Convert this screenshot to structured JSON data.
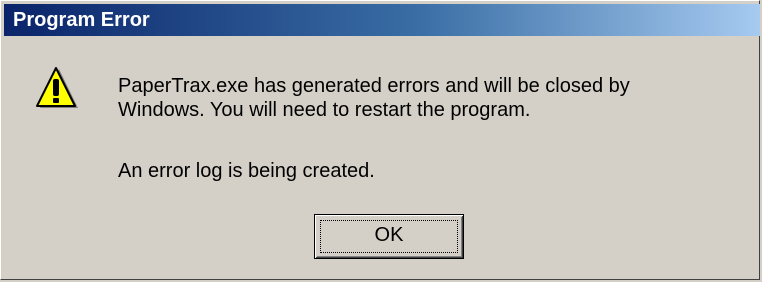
{
  "window": {
    "title": "Program Error"
  },
  "icon": {
    "name": "warning-icon",
    "fill": "#ffff00",
    "outline": "#000000"
  },
  "message": {
    "line1": "PaperTrax.exe has generated errors and will be closed by",
    "line2": "Windows.  You will need to restart the program.",
    "line3": "An error log is being created."
  },
  "buttons": {
    "ok_label": "OK"
  },
  "colors": {
    "title_bar_start": "#0a246a",
    "title_bar_end": "#a6caf0",
    "dialog_face": "#d4d0c8"
  }
}
